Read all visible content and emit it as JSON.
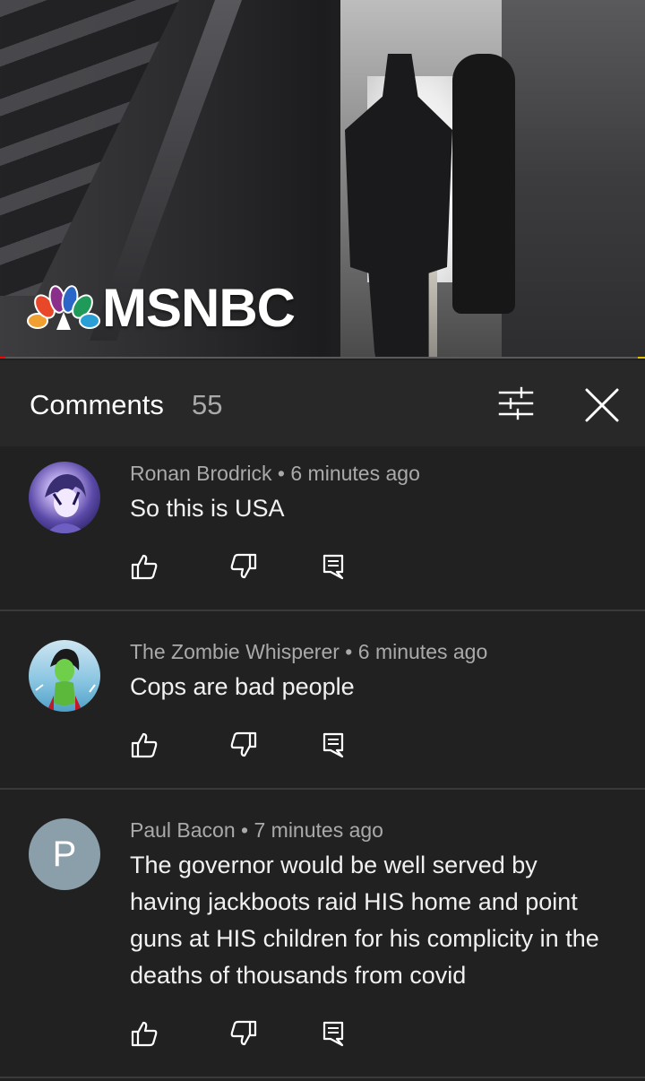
{
  "video": {
    "channel_logo_text": "MSNBC",
    "progress_fraction": 0.008
  },
  "header": {
    "title": "Comments",
    "count": "55"
  },
  "comments": [
    {
      "author": "Ronan Brodrick",
      "time": "6 minutes ago",
      "text": "So this is USA",
      "avatar": "anime-avatar"
    },
    {
      "author": "The Zombie Whisperer",
      "time": "6 minutes ago",
      "text": "Cops are bad people",
      "avatar": "zombie-avatar"
    },
    {
      "author": "Paul Bacon",
      "time": "7 minutes ago",
      "text": "The governor would be well served by having jackboots raid HIS home and point guns at HIS children for his complicity in the deaths of thousands from covid",
      "avatar_letter": "P",
      "avatar_color": "#8b9fab"
    }
  ],
  "separator": " • ",
  "colors": {
    "background": "#212121",
    "header_background": "#282828",
    "secondary_text": "#aaaaaa",
    "progress_played": "#ff0000"
  },
  "icons": {
    "sort": "sort-filter-icon",
    "close": "close-icon",
    "like": "thumbs-up-icon",
    "dislike": "thumbs-down-icon",
    "reply": "reply-icon"
  }
}
